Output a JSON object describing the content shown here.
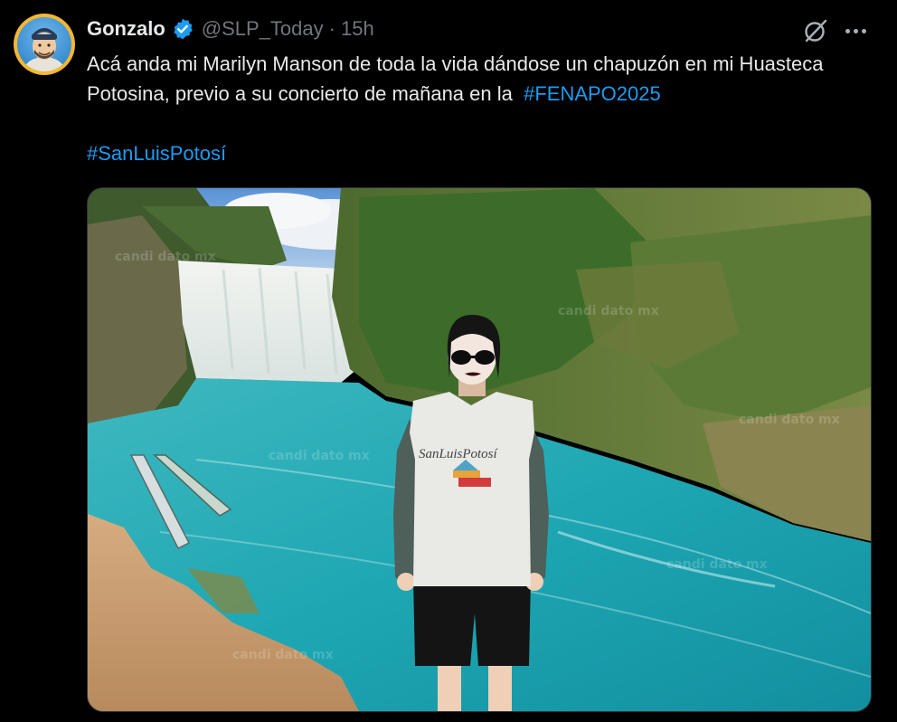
{
  "author": {
    "display_name": "Gonzalo",
    "handle": "@SLP_Today",
    "separator": "·",
    "timestamp": "15h",
    "avatar_icon": "avatar",
    "verified_icon": "verified-badge-icon",
    "verified_color": "#1d9bf0"
  },
  "tweet": {
    "text_part1": "Acá anda mi Marilyn Manson de toda la vida dándose un chapuzón en mi Huasteca Potosina, previo a su concierto de mañana en la",
    "hashtag1": "#FENAPO2025",
    "hashtag2": "#SanLuisPotosí",
    "hashtag_color": "#1d9bf0"
  },
  "media": {
    "shirt_text": "SanLuisPotosí",
    "watermark_text": "candi dato mx"
  },
  "actions": {
    "grok_icon": "grok-icon",
    "more_icon": "more-options-icon"
  }
}
